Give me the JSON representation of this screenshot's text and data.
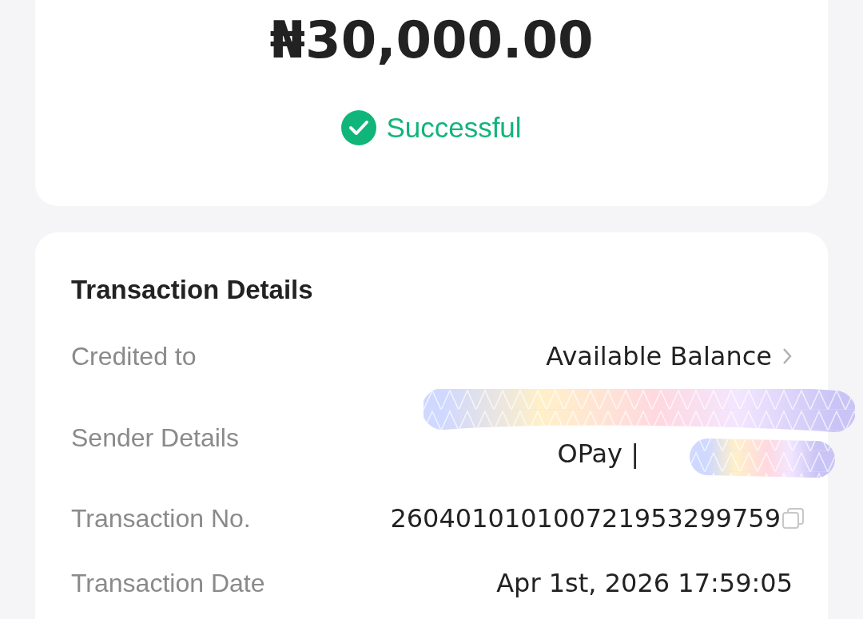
{
  "amount": "₦30,000.00",
  "status": {
    "label": "Successful",
    "kind": "success"
  },
  "details": {
    "title": "Transaction Details",
    "rows": [
      {
        "label": "Credited to",
        "value": "Available Balance",
        "kind": "link"
      },
      {
        "label": "Sender Details",
        "value": "OPay |",
        "kind": "redacted"
      },
      {
        "label": "Transaction No.",
        "value": "260401010100721953299759",
        "kind": "copy"
      },
      {
        "label": "Transaction Date",
        "value": "Apr 1st, 2026 17:59:05",
        "kind": "plain"
      }
    ]
  }
}
